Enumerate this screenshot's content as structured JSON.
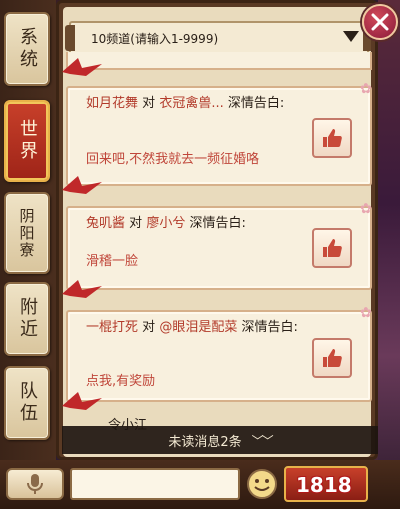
{
  "tabs": [
    {
      "label": "系统"
    },
    {
      "label": "世界"
    },
    {
      "label": "阴阳寮"
    },
    {
      "label": "附近"
    },
    {
      "label": "队伍"
    }
  ],
  "channel": {
    "label": "10频道(请输入1-9999)"
  },
  "messages": [
    {
      "from": "如月花舞",
      "conj": "对",
      "to": "衣冠禽兽...",
      "suffix": "深情告白:",
      "body": "回来吧,不然我就去一频征婚咯"
    },
    {
      "from": "兔叽酱",
      "conj": "对",
      "to": "廖小兮",
      "suffix": "深情告白:",
      "body": "滑稽一脸"
    },
    {
      "from": "一棍打死",
      "conj": "对",
      "to": "@眼泪是配菜",
      "suffix": "深情告白:",
      "body": "点我,有奖励"
    }
  ],
  "partial_name": "令小江",
  "unread": {
    "label": "未读消息2条",
    "chevron": "﹀﹀"
  },
  "watermark": "1818",
  "colors": {
    "accent": "#b23a2a",
    "parchment": "#f8f0de",
    "wood": "#5a3a24"
  }
}
